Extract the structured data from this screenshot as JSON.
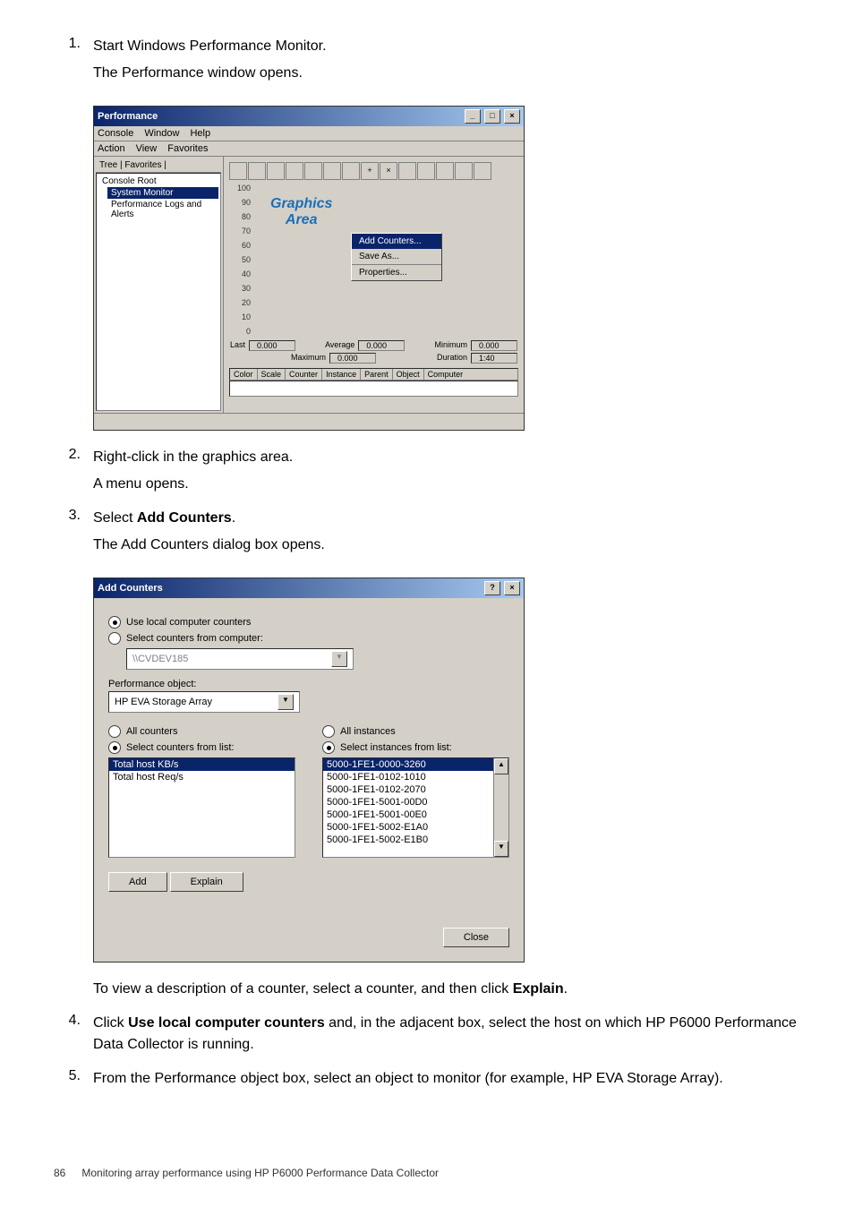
{
  "steps": {
    "s1num": "1.",
    "s1a": "Start Windows Performance Monitor.",
    "s1b": "The Performance window opens.",
    "s2num": "2.",
    "s2a": "Right-click in the graphics area.",
    "s2b": "A menu opens.",
    "s3num": "3.",
    "s3a_pre": "Select ",
    "s3a_bold": "Add Counters",
    "s3a_post": ".",
    "s3b": "The Add Counters dialog box opens.",
    "explain_line_pre": "To view a description of a counter, select a counter, and then click ",
    "explain_bold": "Explain",
    "explain_post": ".",
    "s4num": "4.",
    "s4_pre": "Click ",
    "s4_bold": "Use local computer counters",
    "s4_post": " and, in the adjacent box, select the host on which HP P6000 Performance Data Collector is running.",
    "s5num": "5.",
    "s5": "From the Performance object box, select an object to monitor (for example, HP EVA Storage Array)."
  },
  "perf": {
    "title": "Performance",
    "menu": {
      "console": "Console",
      "window": "Window",
      "help": "Help"
    },
    "menu2": {
      "action": "Action",
      "view": "View",
      "fav": "Favorites"
    },
    "tree_tabs": "Tree | Favorites |",
    "tree": {
      "root": "Console Root",
      "sysmon": "System Monitor",
      "logs": "Performance Logs and Alerts"
    },
    "graphics_label1": "Graphics",
    "graphics_label2": "Area",
    "yaxis": [
      "100",
      "90",
      "80",
      "70",
      "60",
      "50",
      "40",
      "30",
      "20",
      "10",
      "0"
    ],
    "context": {
      "add": "Add Counters...",
      "save": "Save As...",
      "props": "Properties..."
    },
    "stats": {
      "last_l": "Last",
      "last_v": "0.000",
      "avg_l": "Average",
      "avg_v": "0.000",
      "min_l": "Minimum",
      "min_v": "0.000",
      "max_l": "Maximum",
      "max_v": "0.000",
      "dur_l": "Duration",
      "dur_v": "1:40"
    },
    "headers": {
      "color": "Color",
      "scale": "Scale",
      "counter": "Counter",
      "instance": "Instance",
      "parent": "Parent",
      "object": "Object",
      "computer": "Computer"
    }
  },
  "dlg": {
    "title": "Add Counters",
    "r_local": "Use local computer counters",
    "r_select_comp": "Select counters from computer:",
    "computer": "\\\\CVDEV185",
    "perf_obj_label": "Performance object:",
    "perf_obj_value": "HP EVA Storage Array",
    "r_allc": "All counters",
    "r_selc": "Select counters from list:",
    "r_alli": "All instances",
    "r_seli": "Select instances from list:",
    "counters": [
      "Total host KB/s",
      "Total host Req/s"
    ],
    "instances": [
      "5000-1FE1-0000-3260",
      "5000-1FE1-0102-1010",
      "5000-1FE1-0102-2070",
      "5000-1FE1-5001-00D0",
      "5000-1FE1-5001-00E0",
      "5000-1FE1-5002-E1A0",
      "5000-1FE1-5002-E1B0"
    ],
    "btn_add": "Add",
    "btn_explain": "Explain",
    "btn_close": "Close"
  },
  "footer": {
    "page": "86",
    "text": "Monitoring array performance using HP P6000 Performance Data Collector"
  },
  "chart_data": {
    "type": "line",
    "title": "",
    "y_ticks": [
      0,
      10,
      20,
      30,
      40,
      50,
      60,
      70,
      80,
      90,
      100
    ],
    "series": [],
    "stats": {
      "last": 0.0,
      "average": 0.0,
      "minimum": 0.0,
      "maximum": 0.0,
      "duration": "1:40"
    }
  }
}
